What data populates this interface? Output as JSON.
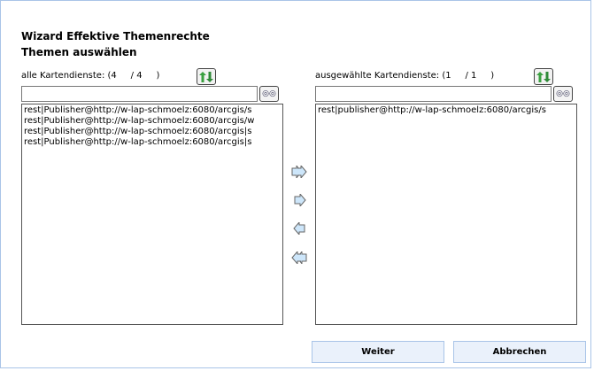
{
  "header": {
    "title": "Wizard Effektive Themenrechte",
    "subtitle": "Themen auswählen"
  },
  "left": {
    "label": "alle Kartendienste: (4     / 4     )",
    "search_value": "",
    "items": [
      "rest|Publisher@http://w-lap-schmoelz:6080/arcgis/s",
      "rest|Publisher@http://w-lap-schmoelz:6080/arcgis/w",
      "rest|Publisher@http://w-lap-schmoelz:6080/arcgis|s",
      "rest|Publisher@http://w-lap-schmoelz:6080/arcgis|s"
    ]
  },
  "right": {
    "label": "ausgewählte Kartendienste: (1     / 1     )",
    "search_value": "",
    "items": [
      "rest|publisher@http://w-lap-schmoelz:6080/arcgis/s"
    ]
  },
  "footer": {
    "next_label": "Weiter",
    "cancel_label": "Abbrechen"
  },
  "colors": {
    "border": "#a9c4e8",
    "button_bg": "#eaf1fb"
  }
}
